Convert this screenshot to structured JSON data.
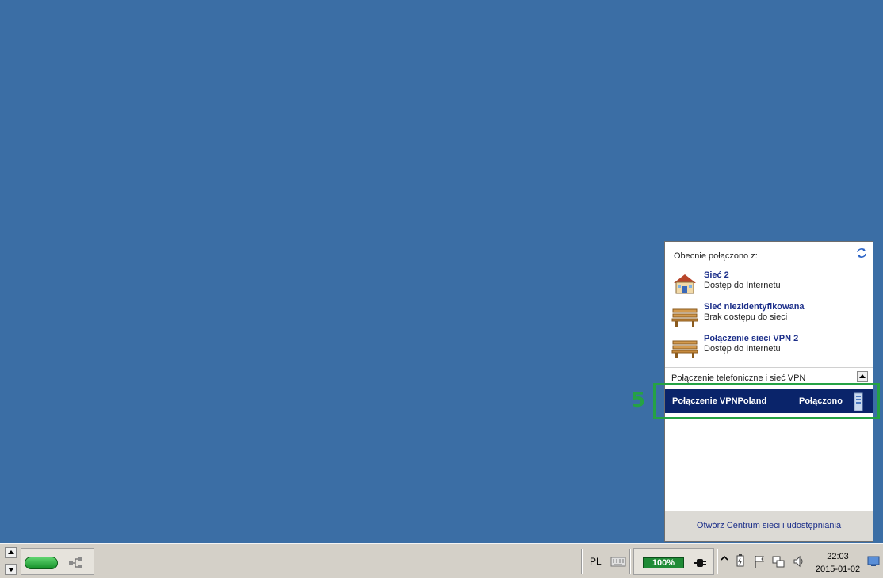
{
  "flyout": {
    "heading": "Obecnie połączono z:",
    "networks": [
      {
        "name": "Sieć  2",
        "status": "Dostęp do Internetu",
        "icon": "home-network-icon"
      },
      {
        "name": "Sieć niezidentyfikowana",
        "status": "Brak dostępu do sieci",
        "icon": "public-bench-icon"
      },
      {
        "name": "Połączenie sieci VPN  2",
        "status": "Dostęp do Internetu",
        "icon": "public-bench-icon"
      }
    ],
    "vpn_section_label": "Połączenie telefoniczne i sieć VPN",
    "vpn_connection": {
      "name": "Połączenie VPNPoland",
      "status": "Połączono",
      "icon": "vpn-server-icon"
    },
    "footer_link": "Otwórz Centrum sieci i udostępniania"
  },
  "annotation": {
    "number": "5",
    "color": "#25a244"
  },
  "taskbar": {
    "language": "PL",
    "battery_percent": "100%",
    "clock_time": "22:03",
    "clock_date": "2015-01-02"
  },
  "colors": {
    "desktop": "#3b6ea5",
    "taskbar": "#d4d0c8",
    "selection": "#0a246a",
    "link": "#1c2f8a"
  }
}
